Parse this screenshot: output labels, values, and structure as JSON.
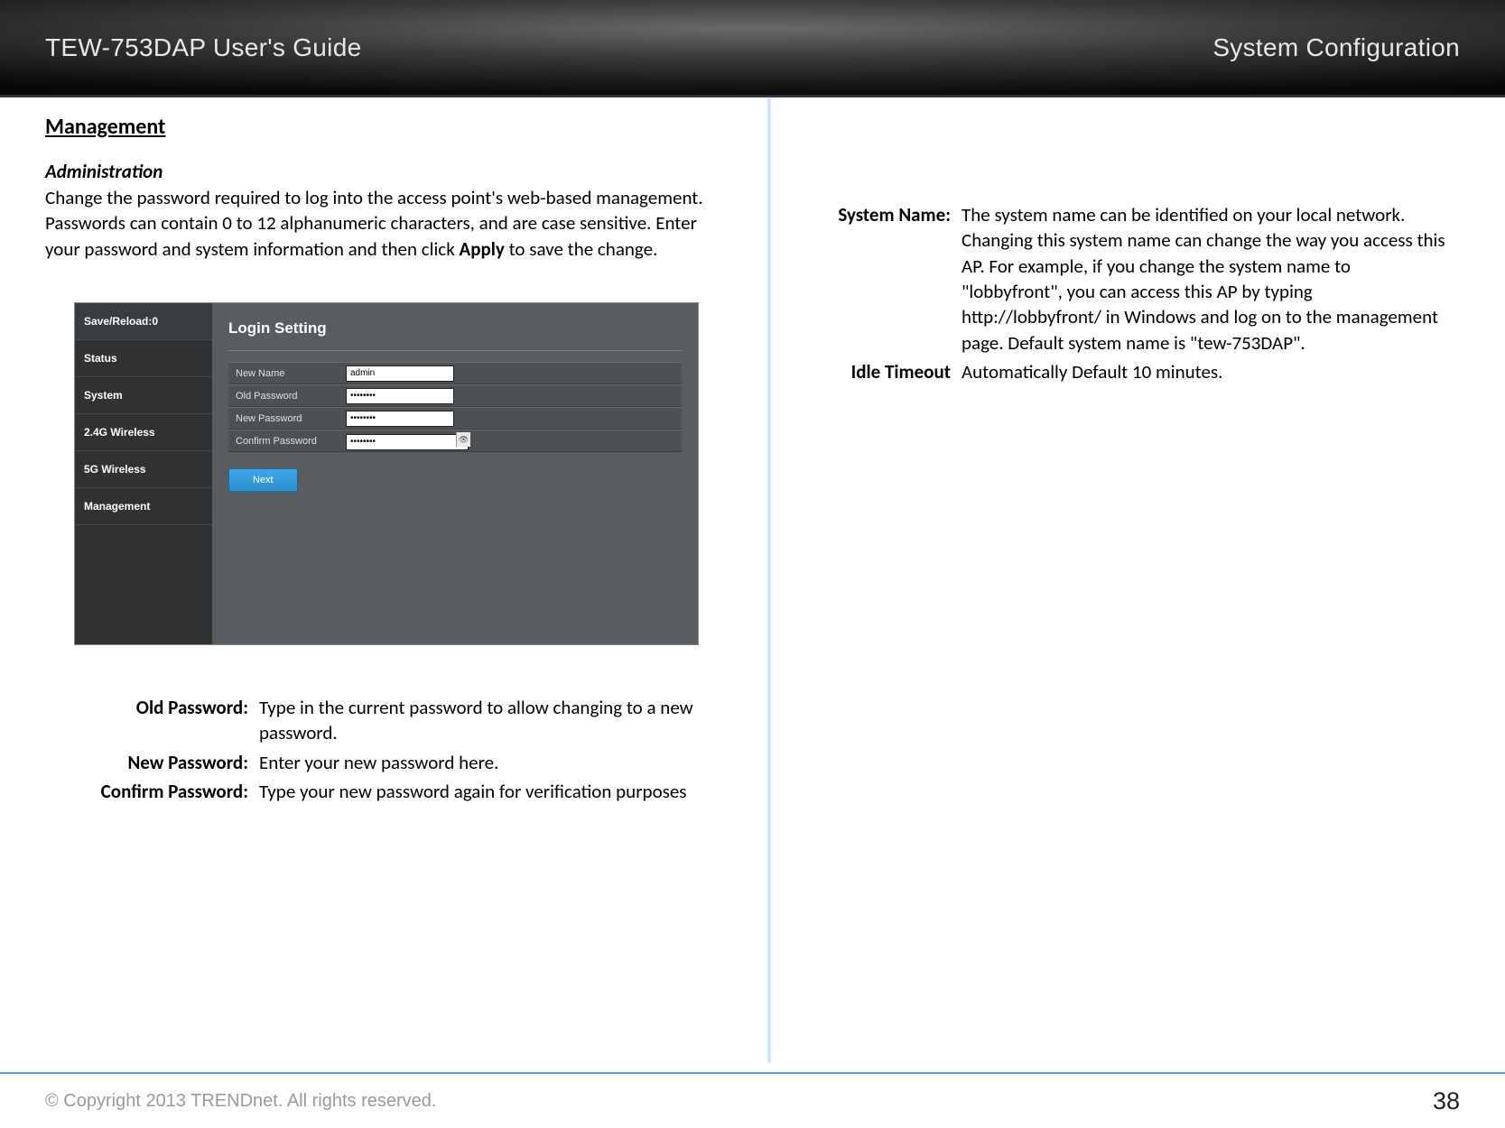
{
  "header": {
    "left": "TEW-753DAP User's Guide",
    "right": "System Configuration"
  },
  "section_title": "Management",
  "subsection_title": "Administration",
  "intro_text_parts": {
    "p1a": "Change the password required to log into the access point's web-based management. Passwords can contain 0 to 12 alphanumeric characters, and are case sensitive. Enter your password and system information and then click ",
    "p1b": "Apply",
    "p1c": " to save the change."
  },
  "screenshot": {
    "sidebar": [
      "Save/Reload:0",
      "Status",
      "System",
      "2.4G Wireless",
      "5G Wireless",
      "Management"
    ],
    "panel_title": "Login Setting",
    "rows": [
      {
        "label": "New Name",
        "value": "admin",
        "type": "text"
      },
      {
        "label": "Old Password",
        "value": "••••••••",
        "type": "password"
      },
      {
        "label": "New Password",
        "value": "••••••••",
        "type": "password"
      },
      {
        "label": "Confirm Password",
        "value": "••••••••",
        "type": "password_eye"
      }
    ],
    "button": "Next"
  },
  "left_defs": [
    {
      "label": "Old Password:",
      "value": "Type in the current password to allow changing to a new password."
    },
    {
      "label": "New Password:",
      "value": "Enter your new password here."
    },
    {
      "label": "Confirm Password:",
      "value": "Type your new password again for verification purposes"
    }
  ],
  "right_defs": [
    {
      "label": "System Name:",
      "value": "The system name can be identified on your local network. Changing this system name can change the way you access this AP. For example, if you change the system name to \"lobbyfront\", you can access this AP by typing http://lobbyfront/ in Windows and log on to the management page. Default system name is \"tew-753DAP\"."
    },
    {
      "label": "Idle Timeout",
      "value": "Automatically Default 10 minutes."
    }
  ],
  "footer": {
    "copyright": "© Copyright 2013 TRENDnet. All rights reserved.",
    "page": "38"
  }
}
